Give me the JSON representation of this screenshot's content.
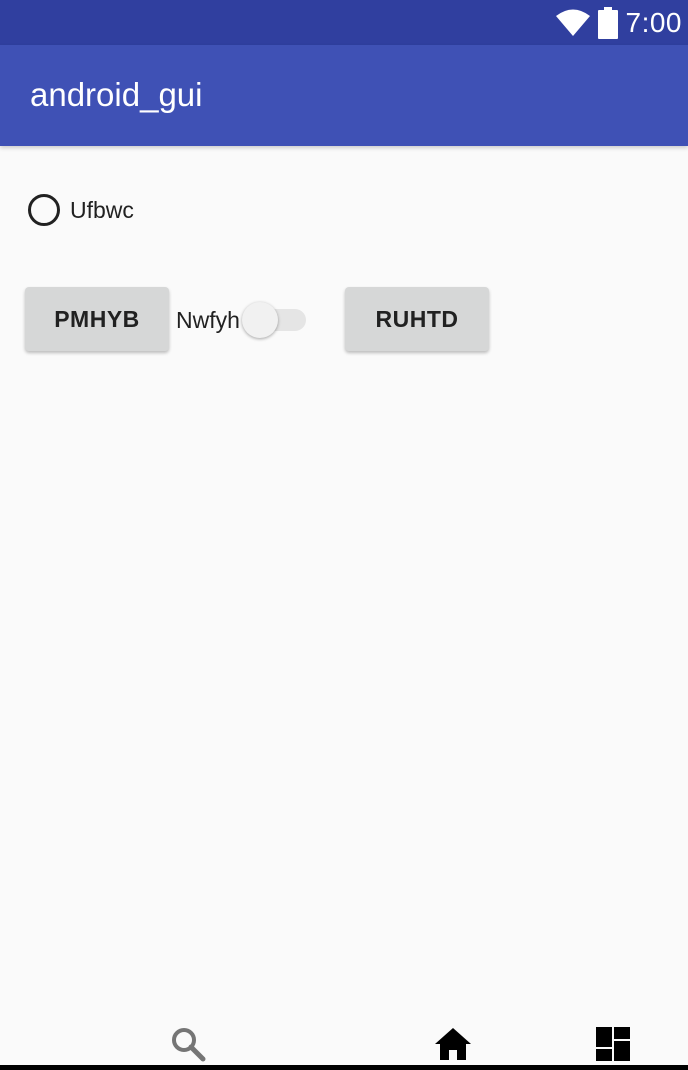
{
  "status_bar": {
    "time": "7:00",
    "icons": [
      "wifi-icon",
      "battery-icon"
    ],
    "color": "#303F9F"
  },
  "app_bar": {
    "title": "android_gui",
    "color": "#3F51B5"
  },
  "content": {
    "radio": {
      "label": "Ufbwc",
      "checked": false
    },
    "button_left": {
      "label": "PMHYB"
    },
    "switch": {
      "label": "Nwfyh",
      "checked": false
    },
    "button_right": {
      "label": "RUHTD"
    }
  },
  "bottom_nav": {
    "items": [
      {
        "icon": "search-icon"
      },
      {
        "icon": "home-icon"
      },
      {
        "icon": "dashboard-icon"
      }
    ]
  }
}
